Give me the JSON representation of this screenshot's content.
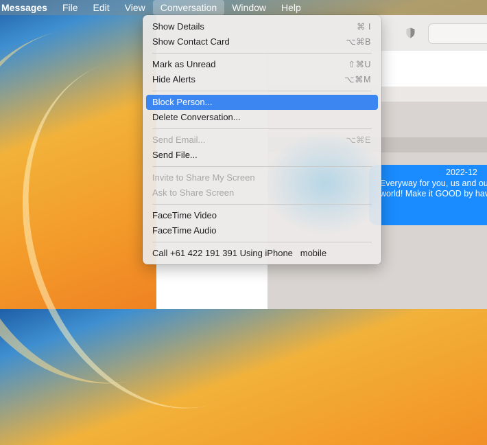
{
  "menubar": {
    "items": [
      "Messages",
      "File",
      "Edit",
      "View",
      "Conversation",
      "Window",
      "Help"
    ],
    "active": "Conversation"
  },
  "menu": {
    "show_details": {
      "label": "Show Details",
      "shortcut": "⌘ I"
    },
    "show_contact_card": {
      "label": "Show Contact Card",
      "shortcut": "⌥⌘B"
    },
    "mark_as_unread": {
      "label": "Mark as Unread",
      "shortcut": "⇧⌘U"
    },
    "hide_alerts": {
      "label": "Hide Alerts",
      "shortcut": "⌥⌘M"
    },
    "block_person": {
      "label": "Block Person..."
    },
    "delete_conversation": {
      "label": "Delete Conversation..."
    },
    "send_email": {
      "label": "Send Email...",
      "shortcut": "⌥⌘E"
    },
    "send_file": {
      "label": "Send File..."
    },
    "invite_share_screen": {
      "label": "Invite to Share My Screen"
    },
    "ask_share_screen": {
      "label": "Ask to Share Screen"
    },
    "facetime_video": {
      "label": "FaceTime Video"
    },
    "facetime_audio": {
      "label": "FaceTime Audio"
    },
    "call": {
      "label": "Call +61 422 191 391 Using iPhone",
      "sublabel": "mobile"
    }
  },
  "conversation": {
    "bubble_lines": [
      "2022-12",
      "Everyway for you, us and ou",
      "world!  Make it GOOD by hav"
    ]
  },
  "colors": {
    "selection": "#3b86f0",
    "bubble": "#1a8cff"
  }
}
